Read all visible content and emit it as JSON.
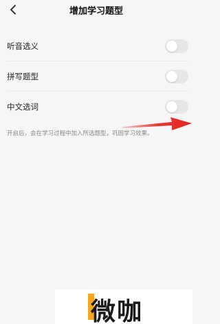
{
  "header": {
    "title": "增加学习题型",
    "back_icon": "chevron-left-icon"
  },
  "settings": [
    {
      "label": "听音选义",
      "enabled": false
    },
    {
      "label": "拼写题型",
      "enabled": false
    },
    {
      "label": "中文选词",
      "enabled": false
    }
  ],
  "hint": "开启后，会在学习过程中加入所选题型，巩固学习效果。",
  "watermark": {
    "text": "微咖"
  },
  "colors": {
    "arrow": "#e8221e",
    "watermark_accent": "#f5a623",
    "toggle_off": "#e6e6e9"
  }
}
